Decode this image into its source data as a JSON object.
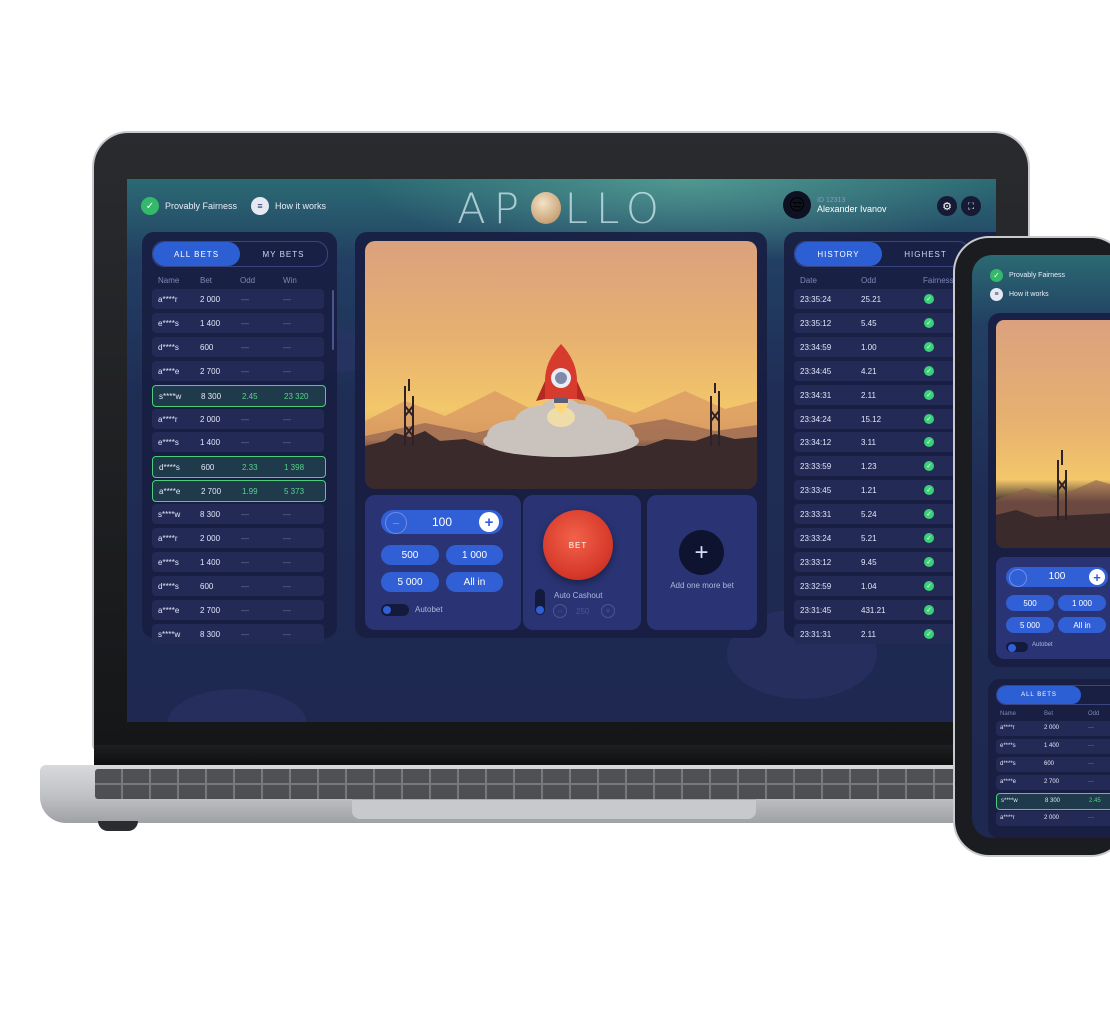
{
  "app": {
    "logo_left": "AP",
    "logo_right": "LLO",
    "provably_fair": "Provably Fairness",
    "how_it_works": "How it works",
    "user_id": "ID 12313",
    "user_name": "Alexander Ivanov"
  },
  "bets_panel": {
    "tabs": [
      "ALL BETS",
      "MY BETS"
    ],
    "columns": [
      "Name",
      "Bet",
      "Odd",
      "Win"
    ],
    "rows": [
      {
        "name": "a****r",
        "bet": "2 000",
        "odd": "—",
        "win": "—",
        "won": false
      },
      {
        "name": "e****s",
        "bet": "1 400",
        "odd": "—",
        "win": "—",
        "won": false
      },
      {
        "name": "d****s",
        "bet": "600",
        "odd": "—",
        "win": "—",
        "won": false
      },
      {
        "name": "a****e",
        "bet": "2 700",
        "odd": "—",
        "win": "—",
        "won": false
      },
      {
        "name": "s****w",
        "bet": "8 300",
        "odd": "2.45",
        "win": "23 320",
        "won": true
      },
      {
        "name": "a****r",
        "bet": "2 000",
        "odd": "—",
        "win": "—",
        "won": false
      },
      {
        "name": "e****s",
        "bet": "1 400",
        "odd": "—",
        "win": "—",
        "won": false
      },
      {
        "name": "d****s",
        "bet": "600",
        "odd": "2.33",
        "win": "1 398",
        "won": true
      },
      {
        "name": "a****e",
        "bet": "2 700",
        "odd": "1.99",
        "win": "5 373",
        "won": true
      },
      {
        "name": "s****w",
        "bet": "8 300",
        "odd": "—",
        "win": "—",
        "won": false
      },
      {
        "name": "a****r",
        "bet": "2 000",
        "odd": "—",
        "win": "—",
        "won": false
      },
      {
        "name": "e****s",
        "bet": "1 400",
        "odd": "—",
        "win": "—",
        "won": false
      },
      {
        "name": "d****s",
        "bet": "600",
        "odd": "—",
        "win": "—",
        "won": false
      },
      {
        "name": "a****e",
        "bet": "2 700",
        "odd": "—",
        "win": "—",
        "won": false
      },
      {
        "name": "s****w",
        "bet": "8 300",
        "odd": "—",
        "win": "—",
        "won": false
      }
    ]
  },
  "history_panel": {
    "tabs": [
      "HISTORY",
      "HIGHEST"
    ],
    "columns": [
      "Date",
      "Odd",
      "Fairness"
    ],
    "rows": [
      {
        "date": "23:35:24",
        "odd": "25.21"
      },
      {
        "date": "23:35:12",
        "odd": "5.45"
      },
      {
        "date": "23:34:59",
        "odd": "1.00"
      },
      {
        "date": "23:34:45",
        "odd": "4.21"
      },
      {
        "date": "23:34:31",
        "odd": "2.11"
      },
      {
        "date": "23:34:24",
        "odd": "15.12"
      },
      {
        "date": "23:34:12",
        "odd": "3.11"
      },
      {
        "date": "23:33:59",
        "odd": "1.23"
      },
      {
        "date": "23:33:45",
        "odd": "1.21"
      },
      {
        "date": "23:33:31",
        "odd": "5.24"
      },
      {
        "date": "23:33:24",
        "odd": "5.21"
      },
      {
        "date": "23:33:12",
        "odd": "9.45"
      },
      {
        "date": "23:32:59",
        "odd": "1.04"
      },
      {
        "date": "23:31:45",
        "odd": "431.21"
      },
      {
        "date": "23:31:31",
        "odd": "2.11"
      }
    ]
  },
  "bet_controls": {
    "amount": "100",
    "minus": "−",
    "plus": "+",
    "quick": [
      "500",
      "1 000",
      "5 000",
      "All in"
    ],
    "autobet": "Autobet",
    "bet_button": "BET",
    "auto_cashout": "Auto Cashout",
    "cashout_value": "250",
    "add_more": "Add one more bet"
  },
  "tablet": {
    "provably_fair": "Provably Fairness",
    "how_it_works": "How it works",
    "amount": "100",
    "quick": [
      "500",
      "1 000",
      "5 000",
      "All in"
    ],
    "autobet": "Autobet",
    "tabs": [
      "ALL BETS"
    ],
    "columns": [
      "Name",
      "Bet",
      "Odd"
    ],
    "rows": [
      {
        "name": "a****r",
        "bet": "2 000",
        "odd": "—",
        "won": false
      },
      {
        "name": "e****s",
        "bet": "1 400",
        "odd": "—",
        "won": false
      },
      {
        "name": "d****s",
        "bet": "600",
        "odd": "—",
        "won": false
      },
      {
        "name": "a****e",
        "bet": "2 700",
        "odd": "—",
        "won": false
      },
      {
        "name": "s****w",
        "bet": "8 300",
        "odd": "2.45",
        "won": true
      },
      {
        "name": "a****r",
        "bet": "2 000",
        "odd": "—",
        "won": false
      }
    ]
  },
  "colors": {
    "accent": "#3160d6",
    "win": "#4bcf7c",
    "bet": "#e0402c"
  }
}
